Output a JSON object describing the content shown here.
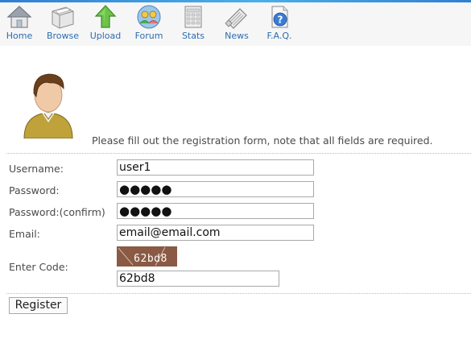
{
  "nav": {
    "items": [
      {
        "label": "Home",
        "icon": "home-icon"
      },
      {
        "label": "Browse",
        "icon": "browse-icon"
      },
      {
        "label": "Upload",
        "icon": "upload-icon"
      },
      {
        "label": "Forum",
        "icon": "forum-icon"
      },
      {
        "label": "Stats",
        "icon": "stats-icon"
      },
      {
        "label": "News",
        "icon": "news-icon"
      },
      {
        "label": "F.A.Q.",
        "icon": "faq-icon"
      }
    ]
  },
  "intro": "Please fill out the registration form, note that all fields are required.",
  "form": {
    "username_label": "Username:",
    "username_value": "user1",
    "password_label": "Password:",
    "password_value": "●●●●●",
    "confirm_label": "Password:(confirm)",
    "confirm_value": "●●●●●",
    "email_label": "Email:",
    "email_value": "email@email.com",
    "code_label": "Enter Code:",
    "captcha_text": "62bd8",
    "code_value": "62bd8",
    "register_label": "Register"
  },
  "colors": {
    "nav_link": "#2b6cb0",
    "captcha_bg": "#8a5a44"
  }
}
